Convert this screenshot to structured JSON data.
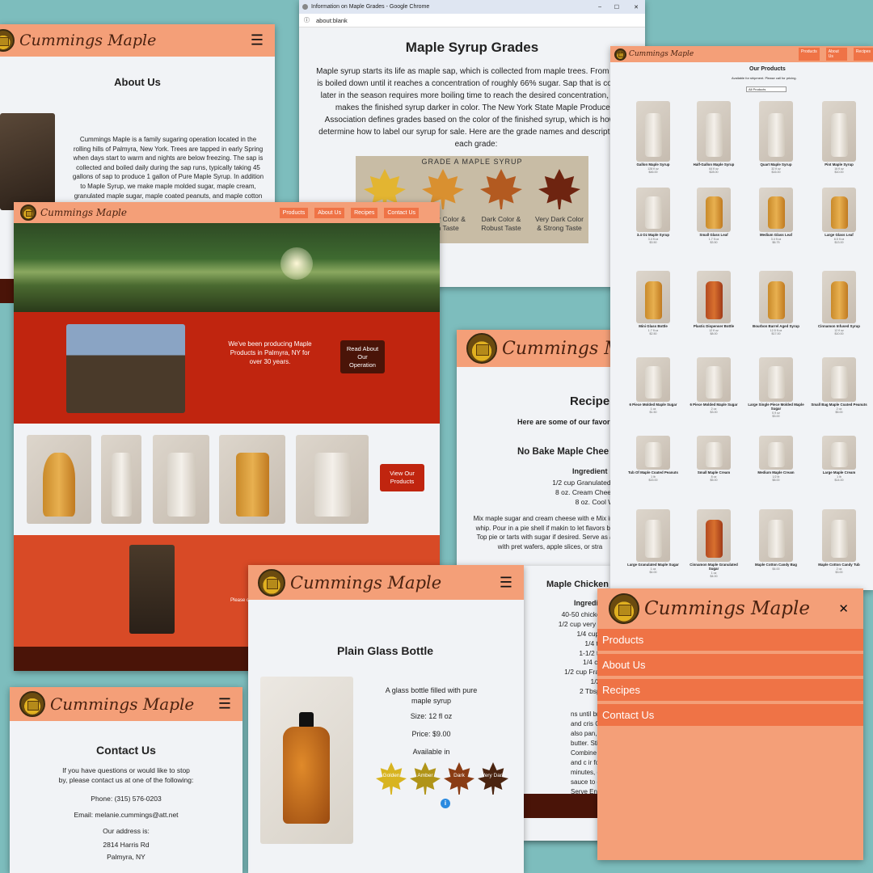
{
  "brand": "Cummings Maple",
  "about": {
    "title": "About Us",
    "body": "Cummings Maple is a family sugaring operation located in the rolling hills of Palmyra, New York. Trees are tapped in early Spring when days start to warm and nights are below freezing. The sap is collected and boiled daily during the sap runs, typically taking 45 gallons of sap to produce 1 gallon of Pure Maple Syrup. In addition to Maple Syrup, we make maple molded sugar, maple cream, granulated maple sugar, maple coated peanuts, and maple cotton candy."
  },
  "chrome": {
    "tab_title": "Information on Maple Grades - Google Chrome",
    "address": "about:blank",
    "min": "–",
    "max": "☐",
    "close": "✕"
  },
  "grades": {
    "title": "Maple Syrup Grades",
    "body": "Maple syrup starts its life as maple sap, which is collected from maple trees. From there it is boiled down until it reaches a concentration of roughly 66% sugar. Sap that is collected later in the season requires more boiling time to reach the desired concentration, which makes the finished syrup darker in color. The New York State Maple Producers Association defines grades based on the color of the finished syrup, which is how we determine how to label our syrup for sale. Here are the grade names and descriptions of each grade:",
    "image_title": "Grade A Maple Syrup",
    "leaves": [
      {
        "label": "Golden Color & Delicate Taste",
        "color": "#e3b531"
      },
      {
        "label": "Amber Color & Rich Taste",
        "color": "#d99030"
      },
      {
        "label": "Dark Color & Robust Taste",
        "color": "#b35a20"
      },
      {
        "label": "Very Dark Color & Strong Taste",
        "color": "#6e2410"
      }
    ]
  },
  "home": {
    "nav": [
      "Products",
      "About Us",
      "Recipes",
      "Contact Us"
    ],
    "intro": "We've been producing Maple Products in Palmyra, NY for over 30 years.",
    "read_about": "Read About Our Operation",
    "view_products": "View Our Products",
    "please": "Please c"
  },
  "products": {
    "nav": [
      "Products",
      "About Us",
      "Recipes"
    ],
    "title": "Our Products",
    "subtitle": "Available for shipment. Please call for pricing.",
    "filter": "All Products",
    "items": [
      {
        "name": "Gallon Maple Syrup",
        "d1": "128 fl oz",
        "d2": "$46.00",
        "k": "w"
      },
      {
        "name": "Half-Gallon Maple Syrup",
        "d1": "64 fl oz",
        "d2": "$28.00",
        "k": "w"
      },
      {
        "name": "Quart Maple Syrup",
        "d1": "32 fl oz",
        "d2": "$16.00",
        "k": "w"
      },
      {
        "name": "Pint Maple Syrup",
        "d1": "16 fl oz",
        "d2": "$10.00",
        "k": "w"
      },
      {
        "name": "3.4 Oz Maple Syrup",
        "d1": "3.4 fl oz",
        "d2": "$3.50",
        "k": "w"
      },
      {
        "name": "Small Glass Leaf",
        "d1": "1.7 fl oz",
        "d2": "$3.50",
        "k": "o"
      },
      {
        "name": "Medium Glass Leaf",
        "d1": "3.4 fl oz",
        "d2": "$6.75",
        "k": "o"
      },
      {
        "name": "Large Glass Leaf",
        "d1": "8.5 fl oz",
        "d2": "$13.00",
        "k": "o"
      },
      {
        "name": "Mini Glass Bottle",
        "d1": "1.7 fl oz",
        "d2": "$2.50",
        "k": "o"
      },
      {
        "name": "Plastic Dispenser Bottle",
        "d1": "12 fl oz",
        "d2": "$8.00",
        "k": "r"
      },
      {
        "name": "Bourbon Barrel Aged Syrup",
        "d1": "12.5 fl oz",
        "d2": "$17.00",
        "k": "o"
      },
      {
        "name": "Cinnamon Infused Syrup",
        "d1": "12 fl oz",
        "d2": "$10.00",
        "k": "o"
      },
      {
        "name": "6 Piece Molded Maple Sugar",
        "d1": "1 oz",
        "d2": "$1.50",
        "k": "w"
      },
      {
        "name": "6 Piece Molded Maple Sugar",
        "d1": "2 oz",
        "d2": "$3.00",
        "k": "w"
      },
      {
        "name": "Large Single Piece Molded Maple Sugar",
        "d1": "0.9 oz",
        "d2": "$3.00",
        "k": "w"
      },
      {
        "name": "Small Bag Maple Coated Peanuts",
        "d1": "2 oz",
        "d2": "$5.00",
        "k": "w"
      },
      {
        "name": "Tub Of Maple Coated Peanuts",
        "d1": "1 lb",
        "d2": "$15.00",
        "k": "w"
      },
      {
        "name": "Small Maple Cream",
        "d1": "8 oz",
        "d2": "$5.00",
        "k": "w"
      },
      {
        "name": "Medium Maple Cream",
        "d1": "1/2 lb",
        "d2": "$8.00",
        "k": "w"
      },
      {
        "name": "Large Maple Cream",
        "d1": "1 lb",
        "d2": "$14.00",
        "k": "w"
      },
      {
        "name": "Large Granulated Maple Sugar",
        "d1": "1 oz",
        "d2": "$4.00",
        "k": "w"
      },
      {
        "name": "Cinnamon Maple Granulated Sugar",
        "d1": "1 oz",
        "d2": "$4.00",
        "k": "r"
      },
      {
        "name": "Maple Cotton Candy Bag",
        "d1": "",
        "d2": "$4.00",
        "k": "w"
      },
      {
        "name": "Maple Cotton Candy Tub",
        "d1": "2 oz",
        "d2": "$3.00",
        "k": "w"
      }
    ]
  },
  "recipes": {
    "title": "Recipe",
    "intro": "Here are some of our favor",
    "r1_title": "No Bake Maple Chee",
    "r1_ing": "Ingredient",
    "r1_list": [
      "1/2 cup Granulated M",
      "8 oz. Cream Cheese",
      "8 oz. Cool Wh"
    ],
    "r1_body": "Mix maple sugar and cream cheese with e Mix in cool whip. Pour in a pie shell if makin to let flavors blend. Top pie or tarts with sugar if desired. Serve as a dip with pret wafers, apple slices, or stra",
    "r2_title": "Maple Chicken",
    "r2_ing": "Ingredi",
    "r2_list": [
      "40-50 chicken w",
      "1/2 cup very dark",
      "1/4 cup bro",
      "1/4 tsp p",
      "1-1/2 tsp c",
      "1/4 cup b",
      "1/2 cup Frank's",
      "1/2 tsp",
      "2 Tbsp col"
    ],
    "r2_body": "ns until brown and cris Can also pan, melt butter. Stir in . Combine water and c ir for 2-5 minutes, or u ith sauce to coat. Serve Enjoy"
  },
  "bottle": {
    "title": "Plain Glass Bottle",
    "desc": "A glass bottle filled with pure maple syrup",
    "size": "Size: 12 fl oz",
    "price": "Price: $9.00",
    "avail": "Available in",
    "leaves": [
      {
        "label": "Golden",
        "color": "#d8b420"
      },
      {
        "label": "Amber",
        "color": "#b09418"
      },
      {
        "label": "Dark",
        "color": "#8a3c14"
      },
      {
        "label": "Very Dark",
        "color": "#4a2410"
      }
    ],
    "info": "i"
  },
  "contact": {
    "title": "Contact Us",
    "intro": "If you have questions or would like to stop by, please contact us at one of the following:",
    "phone": "Phone: (315) 576-0203",
    "email": "Email: melanie.cummings@att.net",
    "addr_label": "Our address is:",
    "addr1": "2814 Harris Rd",
    "addr2": "Palmyra, NY"
  },
  "menu": {
    "close": "✕",
    "items": [
      "Products",
      "About Us",
      "Recipes",
      "Contact Us"
    ]
  }
}
